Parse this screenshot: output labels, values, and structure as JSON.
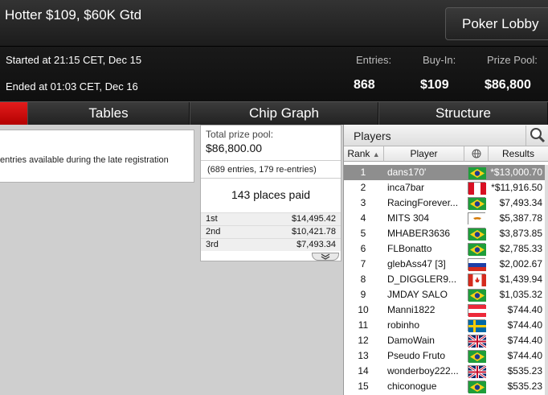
{
  "header": {
    "title": "Hotter $109, $60K Gtd",
    "lobby_button": "Poker Lobby",
    "started": "Started at 21:15 CET, Dec 15",
    "ended": "Ended at 01:03 CET, Dec 16",
    "stats": [
      {
        "label": "Entries:",
        "value": "868"
      },
      {
        "label": "Buy-In:",
        "value": "$109"
      },
      {
        "label": "Prize Pool:",
        "value": "$86,800"
      }
    ]
  },
  "tabs": [
    {
      "label": "Tables"
    },
    {
      "label": "Chip Graph"
    },
    {
      "label": "Structure"
    }
  ],
  "notice": {
    "text": "entries available during the late registration"
  },
  "prize": {
    "label": "Total prize pool:",
    "value": "$86,800.00",
    "entries": "(689 entries, 179 re-entries)",
    "places": "143 places paid",
    "payouts": [
      {
        "place": "1st",
        "amount": "$14,495.42"
      },
      {
        "place": "2nd",
        "amount": "$10,421.78"
      },
      {
        "place": "3rd",
        "amount": "$7,493.34"
      }
    ]
  },
  "players": {
    "title": "Players",
    "columns": {
      "rank": "Rank",
      "player": "Player",
      "results": "Results"
    },
    "rows": [
      {
        "rank": "1",
        "name": "dans170'",
        "result": "*$13,000.70",
        "flag": "brazil"
      },
      {
        "rank": "2",
        "name": "inca7bar",
        "result": "*$11,916.50",
        "flag": "peru"
      },
      {
        "rank": "3",
        "name": "RacingForever...",
        "result": "$7,493.34",
        "flag": "brazil"
      },
      {
        "rank": "4",
        "name": "MITS 304",
        "result": "$5,387.78",
        "flag": "cyprus"
      },
      {
        "rank": "5",
        "name": "MHABER3636",
        "result": "$3,873.85",
        "flag": "brazil"
      },
      {
        "rank": "6",
        "name": "FLBonatto",
        "result": "$2,785.33",
        "flag": "brazil"
      },
      {
        "rank": "7",
        "name": "glebAss47 [3]",
        "result": "$2,002.67",
        "flag": "russia"
      },
      {
        "rank": "8",
        "name": "D_DIGGLER9...",
        "result": "$1,439.94",
        "flag": "canada"
      },
      {
        "rank": "9",
        "name": "JMDAY SALO",
        "result": "$1,035.32",
        "flag": "brazil"
      },
      {
        "rank": "10",
        "name": "Manni1822",
        "result": "$744.40",
        "flag": "austria"
      },
      {
        "rank": "11",
        "name": "robinho",
        "result": "$744.40",
        "flag": "sweden"
      },
      {
        "rank": "12",
        "name": "DamoWain",
        "result": "$744.40",
        "flag": "uk"
      },
      {
        "rank": "13",
        "name": "Pseudo Fruto",
        "result": "$744.40",
        "flag": "brazil"
      },
      {
        "rank": "14",
        "name": "wonderboy222...",
        "result": "$535.23",
        "flag": "uk"
      },
      {
        "rank": "15",
        "name": "chiconogue",
        "result": "$535.23",
        "flag": "brazil"
      }
    ]
  }
}
